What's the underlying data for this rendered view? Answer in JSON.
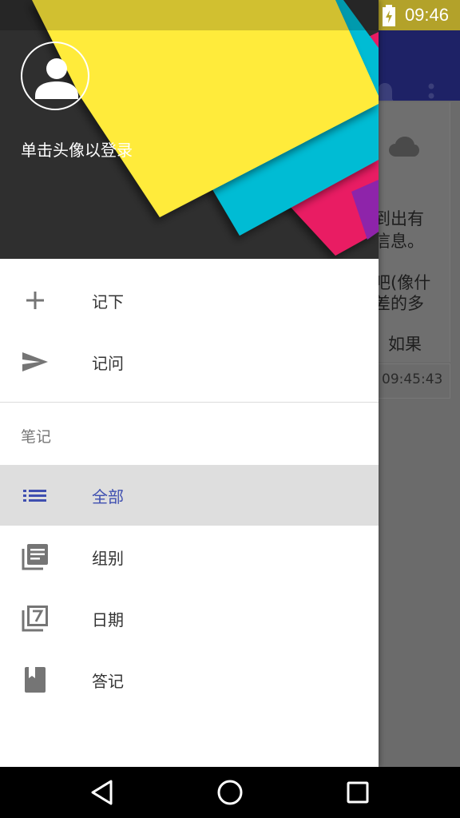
{
  "status_bar": {
    "time": "09:46"
  },
  "app": {
    "card_lines": [
      "到出有",
      "信息。",
      "吧(像什",
      "差的多",
      "如果"
    ],
    "card_time": "09:45:43"
  },
  "drawer": {
    "login_hint": "单击头像以登录",
    "top_items": [
      {
        "icon": "plus-icon",
        "label": "记下"
      },
      {
        "icon": "send-icon",
        "label": "记问"
      }
    ],
    "section_title": "笔记",
    "note_items": [
      {
        "icon": "list-icon",
        "label": "全部",
        "active": true
      },
      {
        "icon": "library-icon",
        "label": "组别"
      },
      {
        "icon": "calendar-7-icon",
        "label": "日期"
      },
      {
        "icon": "book-icon",
        "label": "答记"
      }
    ]
  },
  "colors": {
    "accent": "#3f4fb0",
    "header_bg": "#2f2f2f",
    "yellow": "#ffeb3b",
    "cyan": "#00bcd4",
    "pink": "#e91e63",
    "toolbar": "#1e2266"
  }
}
